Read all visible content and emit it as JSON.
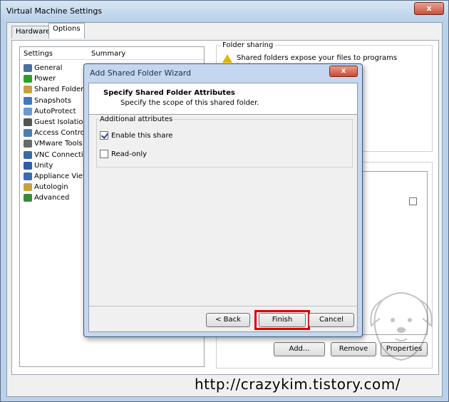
{
  "window": {
    "title": "Virtual Machine Settings",
    "close_label": "x"
  },
  "tabs": [
    {
      "label": "Hardware"
    },
    {
      "label": "Options"
    }
  ],
  "settings_list": {
    "col_settings": "Settings",
    "col_summary": "Summary",
    "items": [
      {
        "label": "General",
        "icon": "general-icon",
        "color": "#4a6fa5"
      },
      {
        "label": "Power",
        "icon": "power-icon",
        "color": "#2aa02a"
      },
      {
        "label": "Shared Folders",
        "icon": "shared-folders-icon",
        "color": "#c8a040"
      },
      {
        "label": "Snapshots",
        "icon": "snapshots-icon",
        "color": "#3a7bbf"
      },
      {
        "label": "AutoProtect",
        "icon": "autoprotect-icon",
        "color": "#6a9ad0"
      },
      {
        "label": "Guest Isolation",
        "icon": "guest-isolation-icon",
        "color": "#555555"
      },
      {
        "label": "Access Control",
        "icon": "access-control-icon",
        "color": "#4a7fb0"
      },
      {
        "label": "VMware Tools",
        "icon": "vmware-tools-icon",
        "color": "#6a6a6a"
      },
      {
        "label": "VNC Connections",
        "icon": "vnc-icon",
        "color": "#3a6aa0"
      },
      {
        "label": "Unity",
        "icon": "unity-icon",
        "color": "#2e5fa8"
      },
      {
        "label": "Appliance View",
        "icon": "appliance-view-icon",
        "color": "#3c6cb0"
      },
      {
        "label": "Autologin",
        "icon": "autologin-icon",
        "color": "#c8a040"
      },
      {
        "label": "Advanced",
        "icon": "advanced-icon",
        "color": "#3a8a3a"
      }
    ]
  },
  "folder_sharing": {
    "label": "Folder sharing",
    "text": "Shared folders expose your files to programs in the"
  },
  "folders_buttons": {
    "add": "Add...",
    "remove": "Remove",
    "properties": "Properties"
  },
  "dialog": {
    "title": "Add Shared Folder Wizard",
    "close_label": "x",
    "heading": "Specify Shared Folder Attributes",
    "subheading": "Specify the scope of this shared folder.",
    "group_label": "Additional attributes",
    "enable_share": {
      "label": "Enable this share",
      "checked": true
    },
    "read_only": {
      "label": "Read-only",
      "checked": false
    },
    "back": "< Back",
    "finish": "Finish",
    "cancel": "Cancel"
  },
  "watermark": "http://crazykim.tistory.com/",
  "colors": {
    "highlight": "#e00000",
    "window_frame": "#b9d1ea"
  }
}
